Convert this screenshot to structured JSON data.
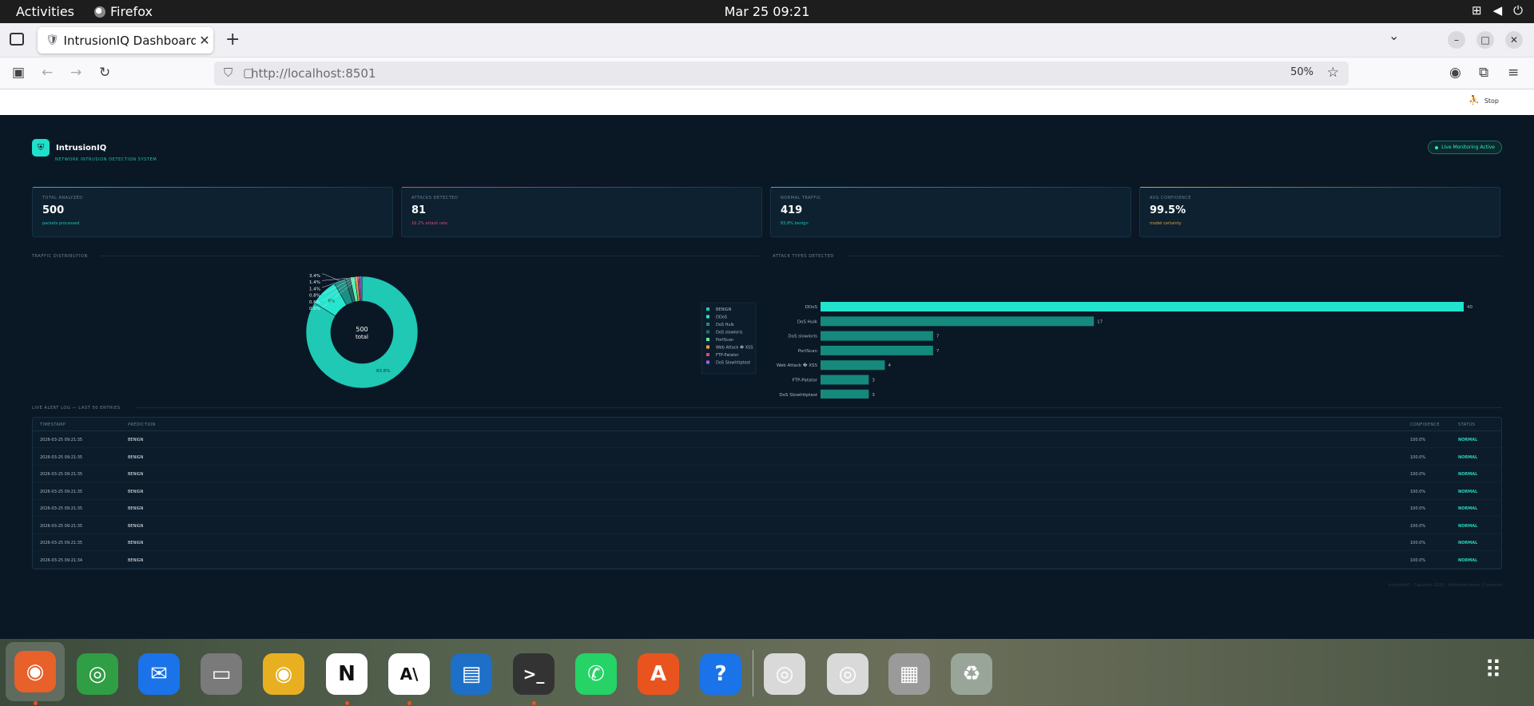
{
  "system": {
    "activities": "Activities",
    "app_name": "Firefox",
    "datetime": "Mar 25  09:21"
  },
  "browser": {
    "tab_title": "IntrusionIQ Dashboard",
    "url": "http://localhost:8501",
    "zoom": "50%"
  },
  "streamlit": {
    "running_label": "Stop"
  },
  "header": {
    "title": "IntrusionIQ",
    "subtitle": "NETWORK INTRUSION DETECTION SYSTEM",
    "badge": "Live Monitoring Active"
  },
  "cards": [
    {
      "label": "TOTAL ANALYZED",
      "value": "500",
      "sub": "packets processed",
      "accent": "#1fc3af"
    },
    {
      "label": "ATTACKS DETECTED",
      "value": "81",
      "sub": "16.2% attack rate",
      "accent": "#e0457b"
    },
    {
      "label": "NORMAL TRAFFIC",
      "value": "419",
      "sub": "83.8% benign",
      "accent": "#1fc3af"
    },
    {
      "label": "AVG CONFIDENCE",
      "value": "99.5%",
      "sub": "model certainty",
      "accent": "#d9a43a"
    }
  ],
  "sections": {
    "traffic": "TRAFFIC DISTRIBUTION",
    "attacks": "ATTACK TYPES DETECTED",
    "log": "LIVE ALERT LOG — LAST 50 ENTRIES"
  },
  "chart_data": [
    {
      "type": "pie",
      "title": "",
      "center_value": "500",
      "center_label": "total",
      "labels": [
        "BENIGN",
        "DDoS",
        "DoS Hulk",
        "DoS slowloris",
        "PortScan",
        "Web Attack � XSS",
        "FTP-Patator",
        "DoS Slowhttptest"
      ],
      "values": [
        419,
        40,
        17,
        7,
        7,
        4,
        3,
        3
      ],
      "slice_labels": [
        "83.8%",
        "8%",
        "3.4%",
        "1.4%",
        "1.4%",
        "0.8%",
        "0.6%",
        "0.6%"
      ],
      "colors": [
        "#1fc9b4",
        "#26e6cf",
        "#1a8f83",
        "#2a6a68",
        "#56f0b0",
        "#f0a04a",
        "#e0457b",
        "#8c6cf0"
      ],
      "legend_position": "right"
    },
    {
      "type": "bar",
      "orientation": "horizontal",
      "title": "",
      "categories": [
        "DDoS",
        "DoS Hulk",
        "DoS slowloris",
        "PortScan",
        "Web Attack � XSS",
        "FTP-Patator",
        "DoS Slowhttptest"
      ],
      "values": [
        40,
        17,
        7,
        7,
        4,
        3,
        3
      ],
      "xlim": [
        0,
        40
      ],
      "xticks": [
        0,
        5,
        10,
        15,
        20,
        25,
        30,
        35,
        40
      ],
      "colors": [
        "#22e3cd",
        "#14897c",
        "#14897c",
        "#14897c",
        "#14897c",
        "#14897c",
        "#14897c"
      ]
    }
  ],
  "log": {
    "columns": [
      "TIMESTAMP",
      "PREDICTION",
      "CONFIDENCE",
      "STATUS"
    ],
    "rows": [
      [
        "2026-03-25 09:21:35",
        "BENIGN",
        "100.0%",
        "NORMAL"
      ],
      [
        "2026-03-25 09:21:35",
        "BENIGN",
        "100.0%",
        "NORMAL"
      ],
      [
        "2026-03-25 09:21:35",
        "BENIGN",
        "100.0%",
        "NORMAL"
      ],
      [
        "2026-03-25 09:21:35",
        "BENIGN",
        "100.0%",
        "NORMAL"
      ],
      [
        "2026-03-25 09:21:35",
        "BENIGN",
        "100.0%",
        "NORMAL"
      ],
      [
        "2026-03-25 09:21:35",
        "BENIGN",
        "100.0%",
        "NORMAL"
      ],
      [
        "2026-03-25 09:21:35",
        "BENIGN",
        "100.0%",
        "NORMAL"
      ],
      [
        "2026-03-25 09:21:34",
        "BENIGN",
        "100.0%",
        "NORMAL"
      ]
    ]
  },
  "footer": "IntrusionIQ · Capstone 2026 · Refreshed every 2 seconds",
  "dock": [
    {
      "name": "firefox",
      "color": "#e8602a",
      "glyph": "◉"
    },
    {
      "name": "chrome",
      "color": "#2f9e44",
      "glyph": "◎"
    },
    {
      "name": "thunderbird",
      "color": "#1a73e8",
      "glyph": "✉"
    },
    {
      "name": "files",
      "color": "#7a7a7a",
      "glyph": "▭"
    },
    {
      "name": "rhythmbox",
      "color": "#e8b020",
      "glyph": "◉"
    },
    {
      "name": "notion",
      "color": "#ffffff",
      "glyph": "N"
    },
    {
      "name": "anthropic",
      "color": "#ffffff",
      "glyph": "A\\"
    },
    {
      "name": "writer",
      "color": "#1d6fc7",
      "glyph": "▤"
    },
    {
      "name": "terminal",
      "color": "#333333",
      "glyph": ">_"
    },
    {
      "name": "whatsapp",
      "color": "#25d366",
      "glyph": "✆"
    },
    {
      "name": "app-center",
      "color": "#e9541e",
      "glyph": "A"
    },
    {
      "name": "help",
      "color": "#1a73e8",
      "glyph": "?"
    },
    {
      "name": "disc-1",
      "color": "#d9d9d9",
      "glyph": "◎"
    },
    {
      "name": "disc-2",
      "color": "#d9d9d9",
      "glyph": "◎"
    },
    {
      "name": "save-drive",
      "color": "#9a9a9a",
      "glyph": "▦"
    },
    {
      "name": "trash",
      "color": "#9aa59a",
      "glyph": "♻"
    }
  ]
}
